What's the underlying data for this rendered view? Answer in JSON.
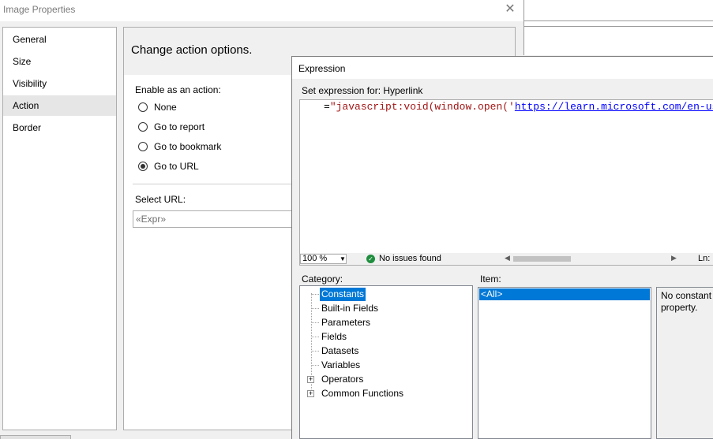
{
  "image_properties": {
    "title": "Image Properties",
    "close_glyph": "✕",
    "nav": {
      "items": [
        "General",
        "Size",
        "Visibility",
        "Action",
        "Border"
      ],
      "selected": "Action"
    },
    "action_page": {
      "title": "Change action options.",
      "enable_label": "Enable as an action:",
      "options": [
        "None",
        "Go to report",
        "Go to bookmark",
        "Go to URL"
      ],
      "selected_option": "Go to URL",
      "select_url_label": "Select URL:",
      "url_value": "«Expr»"
    }
  },
  "expression": {
    "title": "Expression",
    "set_for_label": "Set expression for: Hyperlink",
    "code_prefix": "=",
    "code_string": "\"javascript:void(window.open('",
    "code_link": "https://learn.microsoft.com/en-us/",
    "zoom": "100 %",
    "status": "No issues found",
    "ln_label": "Ln:",
    "category_label": "Category:",
    "item_label": "Item:",
    "categories": [
      "Constants",
      "Built-in Fields",
      "Parameters",
      "Fields",
      "Datasets",
      "Variables",
      "Operators",
      "Common Functions"
    ],
    "selected_category": "Constants",
    "item_selected": "<All>",
    "description": "No constant property."
  }
}
